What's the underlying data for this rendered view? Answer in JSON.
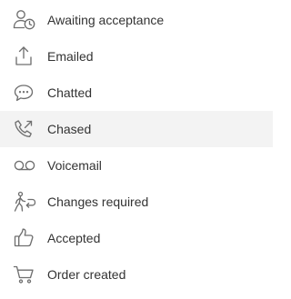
{
  "status_menu": {
    "items": [
      {
        "label": "Awaiting acceptance",
        "icon": "user-clock-icon"
      },
      {
        "label": "Emailed",
        "icon": "upload-tray-icon"
      },
      {
        "label": "Chatted",
        "icon": "speech-bubble-icon"
      },
      {
        "label": "Chased",
        "icon": "phone-outgoing-icon"
      },
      {
        "label": "Voicemail",
        "icon": "voicemail-icon"
      },
      {
        "label": "Changes required",
        "icon": "person-walking-arrow-icon"
      },
      {
        "label": "Accepted",
        "icon": "thumbs-up-icon"
      },
      {
        "label": "Order created",
        "icon": "shopping-cart-icon"
      }
    ],
    "active_item": "Chased",
    "colors": {
      "active_background": "#f3f3f3",
      "icon": "#6f6f6f",
      "text": "#333333"
    }
  }
}
